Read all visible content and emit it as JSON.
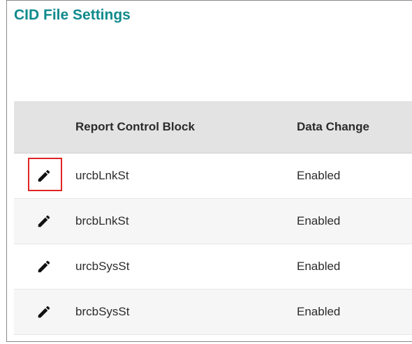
{
  "page": {
    "title": "CID File Settings"
  },
  "table": {
    "headers": {
      "icon": "",
      "name": "Report Control Block",
      "data_change": "Data Change"
    },
    "rows": [
      {
        "name": "urcbLnkSt",
        "data_change": "Enabled",
        "highlighted": true
      },
      {
        "name": "brcbLnkSt",
        "data_change": "Enabled",
        "highlighted": false
      },
      {
        "name": "urcbSysSt",
        "data_change": "Enabled",
        "highlighted": false
      },
      {
        "name": "brcbSysSt",
        "data_change": "Enabled",
        "highlighted": false
      }
    ]
  },
  "icons": {
    "row_action": "pencil-edit-icon"
  },
  "colors": {
    "title": "#0f8a8c",
    "header_bg": "#e3e3e3",
    "alt_row_bg": "#f6f6f6",
    "highlight": "#e02424"
  }
}
